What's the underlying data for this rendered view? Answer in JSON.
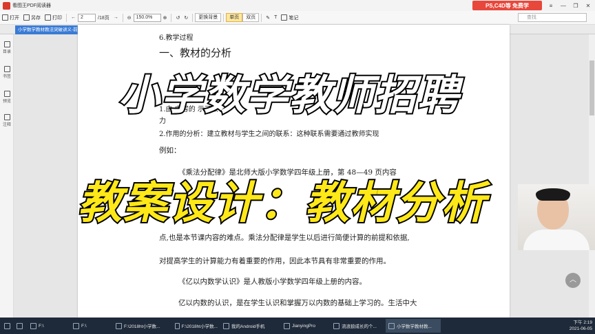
{
  "window": {
    "title": "看图王PDF阅读器",
    "promo": "PS,C4D等 免费学"
  },
  "toolbar": {
    "open": "打开",
    "saveas": "另存",
    "print": "打印",
    "page_current": "2",
    "page_total": "/18页",
    "zoom": "150.0%",
    "bg": "更换背景",
    "single": "单页",
    "double": "双页",
    "note": "笔记",
    "search_placeholder": "查找"
  },
  "tab": {
    "label": "小学数学教材教法突破讲义-前言"
  },
  "sidebar": {
    "items": [
      "目录",
      "书签",
      "预览",
      "注释"
    ]
  },
  "document": {
    "heading_small": "6.教学过程",
    "heading": "一、教材的分析",
    "line1": "1.由    内容的    示了教                                    能",
    "line2": "力",
    "line3": "2.作用的分析：建立教材与学生之间的联系：这种联系需要通过教师实现",
    "example": "例如：",
    "p1": "《乘法分配律》是北师大版小学数学四年级上册，第 48—49 页内容",
    "p2a": "点,也是本节课内容的难点。乘法分配律是学生以后进行简便计算的前提和依据,",
    "p2b": "对提高学生的计算能力有着重要的作用，因此本节具有非常重要的作用。",
    "p3": "《亿以内数学认识》是人教版小学数学四年级上册的内容。",
    "p4": "亿以内数的认识，是在学生认识和掌握万以内数的基础上学习的。生活中大"
  },
  "overlay": {
    "line1": "小学数学教师招聘",
    "line2": "教案设计：教材分析"
  },
  "taskbar": {
    "items": [
      "F:\\",
      "F:\\",
      "F:\\2018ht小学数...",
      "F:\\2018ht小学数...",
      "我的Android手机",
      "JianyingPro",
      "流浪狼成长的个...",
      "小学数学教材教..."
    ],
    "time": "下午 2:19",
    "date": "2021-06-05"
  }
}
